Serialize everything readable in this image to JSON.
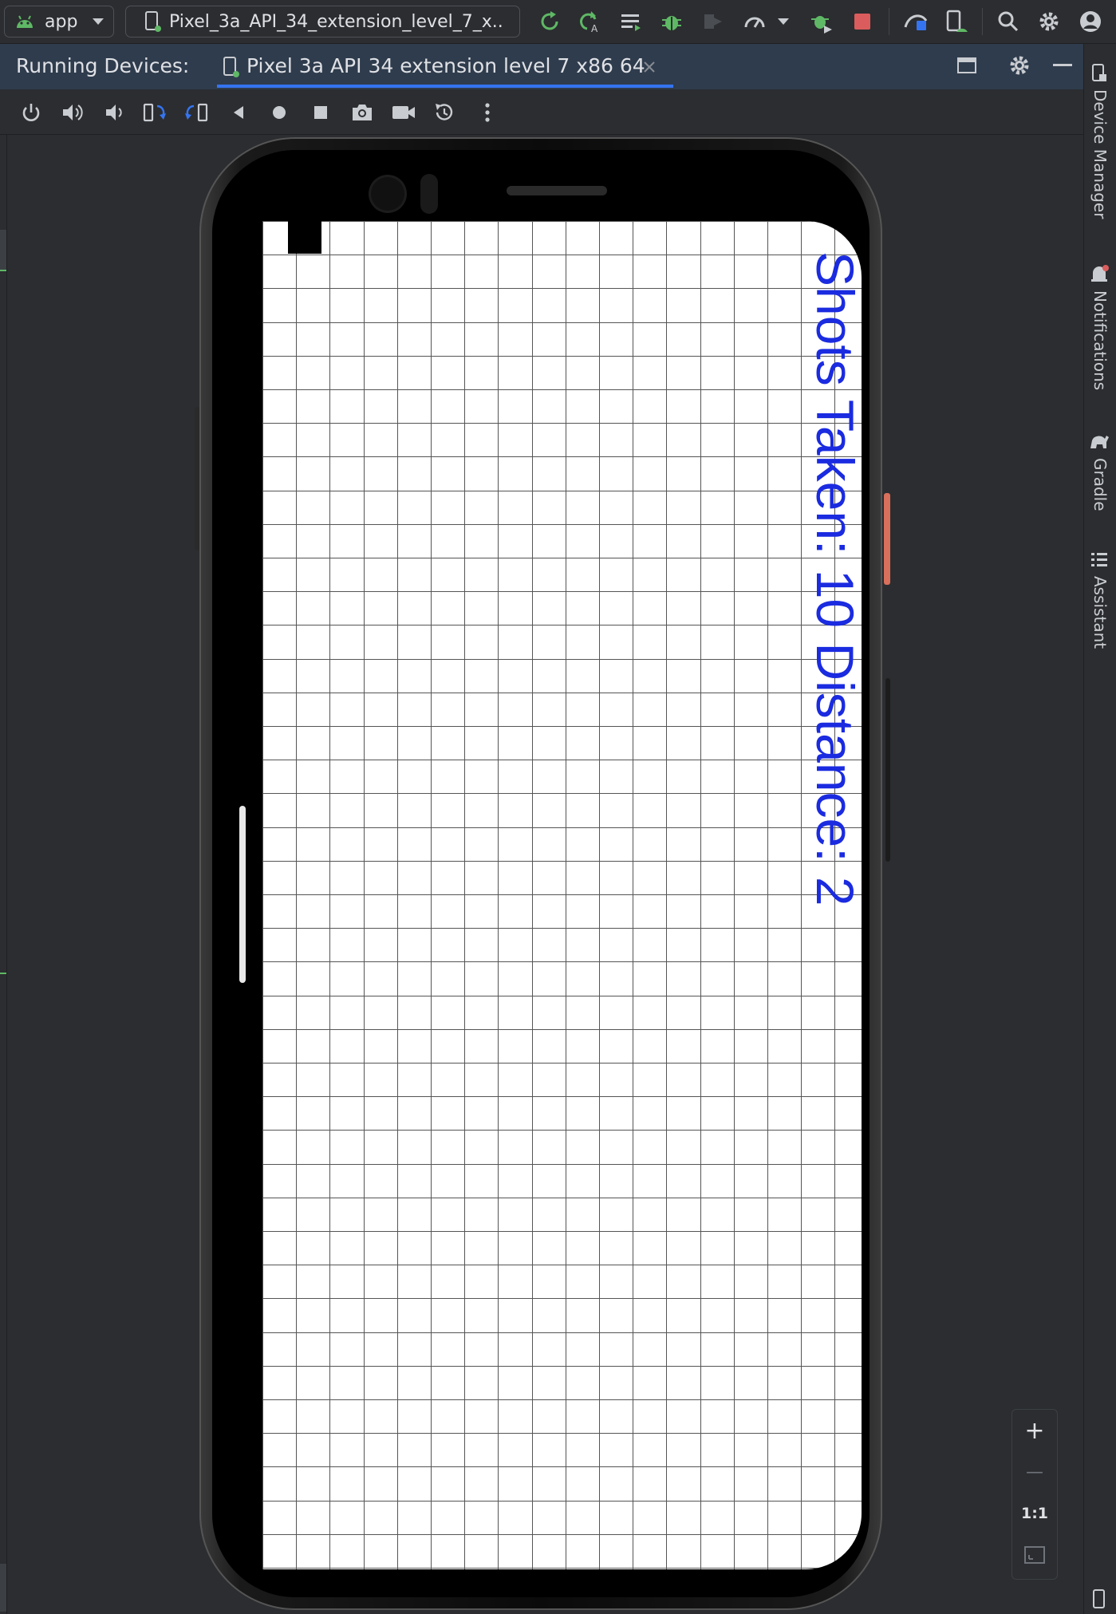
{
  "toolbar": {
    "module_label": "app",
    "device_combo_label": "Pixel_3a_API_34_extension_level_7_x..."
  },
  "running_devices": {
    "label": "Running Devices:",
    "tab_label": "Pixel 3a API 34 extension level 7 x86 64"
  },
  "side_panel": {
    "device_manager": "Device Manager",
    "notifications": "Notifications",
    "gradle": "Gradle",
    "assistant": "Assistant"
  },
  "app_screen": {
    "status_text": "Shots Taken: 10  Distance: 2",
    "grid_columns": 18,
    "grid_rows": 40,
    "marked_cell": {
      "column": 1,
      "row": 0
    },
    "text_color": "#1a2be0"
  },
  "zoom": {
    "zoom_in": "+",
    "zoom_out": "—",
    "actual_size": "1:1"
  },
  "colors": {
    "accent": "#3574f0",
    "stop": "#db5c5c",
    "run_green": "#5fb865"
  }
}
